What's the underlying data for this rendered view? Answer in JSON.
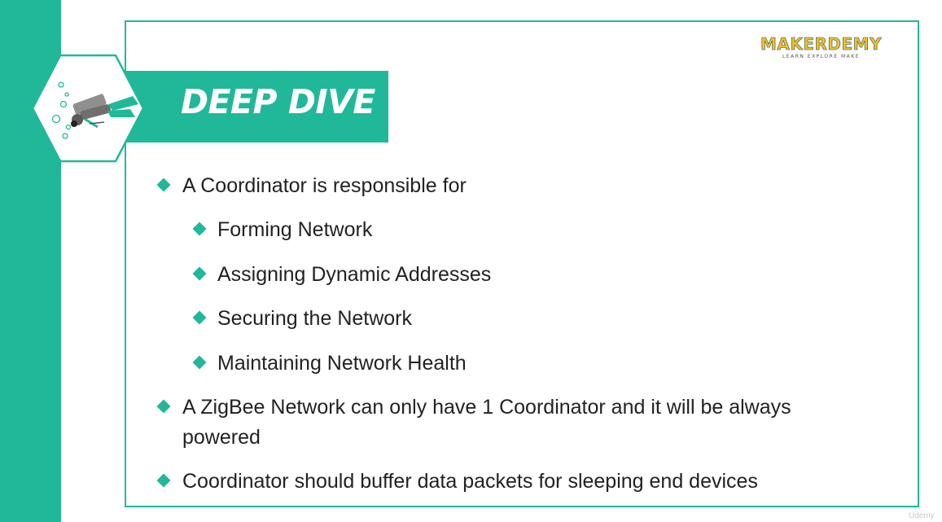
{
  "title": "DEEP DIVE",
  "logo": {
    "name": "MAKERDEMY",
    "tagline": "LEARN EXPLORE MAKE"
  },
  "bullets": [
    {
      "level": 1,
      "text": "A Coordinator is responsible for"
    },
    {
      "level": 2,
      "text": "Forming Network"
    },
    {
      "level": 2,
      "text": "Assigning Dynamic Addresses"
    },
    {
      "level": 2,
      "text": "Securing the Network"
    },
    {
      "level": 2,
      "text": "Maintaining Network Health"
    },
    {
      "level": 1,
      "text": "A ZigBee Network can only have 1 Coordinator and it will be always"
    },
    {
      "level": 1,
      "text": "powered"
    },
    {
      "level": 1,
      "text": "Coordinator should buffer data packets for sleeping end devices"
    }
  ],
  "watermark": "Udemy",
  "colors": {
    "accent": "#21b89a",
    "logo_yellow": "#f3c21b",
    "logo_blue": "#1c4f8a",
    "text": "#222222"
  }
}
